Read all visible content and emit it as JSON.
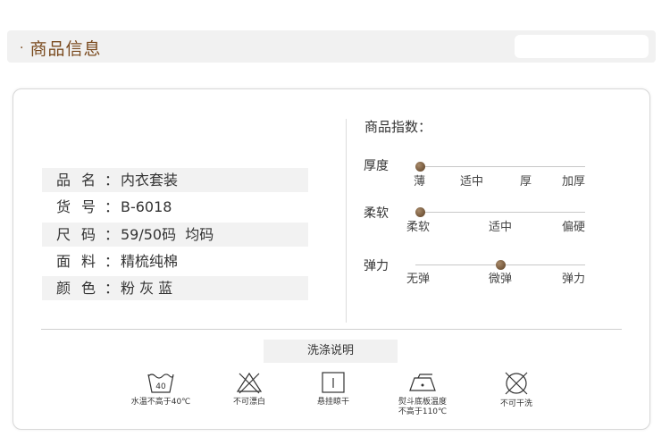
{
  "header": {
    "dot": "·",
    "title": "商品信息"
  },
  "attributes": [
    {
      "key": "品名",
      "value": "内衣套装"
    },
    {
      "key": "货号",
      "value": "B-6018"
    },
    {
      "key": "尺码",
      "value": "59/50码  均码"
    },
    {
      "key": "面料",
      "value": "精梳纯棉"
    },
    {
      "key": "颜色",
      "value": "粉 灰 蓝"
    }
  ],
  "colon": "：",
  "index": {
    "title": "商品指数：",
    "scales": [
      {
        "name": "厚度",
        "labels": [
          "薄",
          "适中",
          "厚",
          "加厚"
        ],
        "level": 0
      },
      {
        "name": "柔软",
        "labels": [
          "柔软",
          "适中",
          "偏硬"
        ],
        "level": 0
      },
      {
        "name": "弹力",
        "labels": [
          "无弹",
          "微弹",
          "弹力"
        ],
        "level": 0.5
      }
    ]
  },
  "wash": {
    "title": "洗涤说明",
    "items": [
      {
        "icon": "wash-40-icon",
        "label": "水温不高于40℃",
        "label2": ""
      },
      {
        "icon": "no-bleach-icon",
        "label": "不可漂白",
        "label2": ""
      },
      {
        "icon": "hang-dry-icon",
        "label": "悬挂晾干",
        "label2": ""
      },
      {
        "icon": "iron-icon",
        "label": "熨斗底板温度",
        "label2": "不高于110℃"
      },
      {
        "icon": "no-dry-clean-icon",
        "label": "不可干洗",
        "label2": ""
      }
    ],
    "tub_temp": "40"
  }
}
